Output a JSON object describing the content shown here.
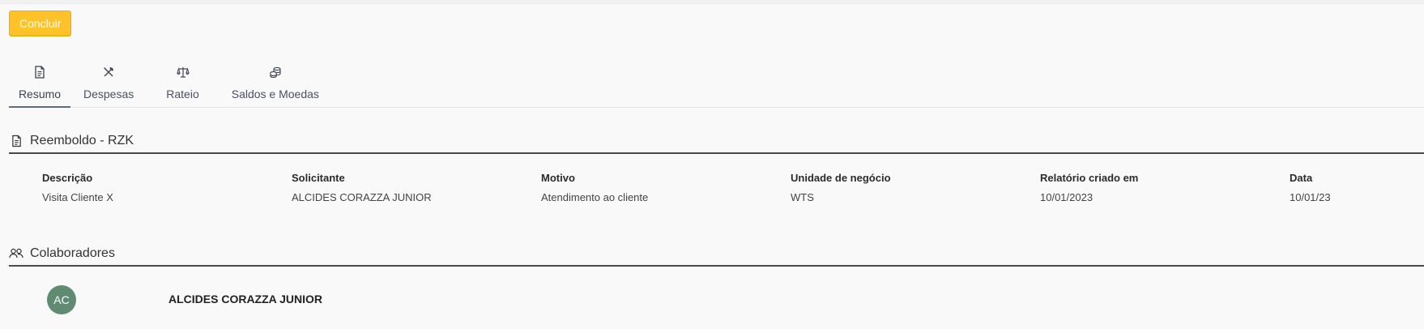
{
  "actions": {
    "conclude_label": "Concluir"
  },
  "tabs": [
    {
      "label": "Resumo",
      "icon": "document-icon",
      "active": true
    },
    {
      "label": "Despesas",
      "icon": "utensils-icon",
      "active": false
    },
    {
      "label": "Rateio",
      "icon": "scale-icon",
      "active": false
    },
    {
      "label": "Saldos e Moedas",
      "icon": "coins-icon",
      "active": false
    }
  ],
  "summary": {
    "title": "Reemboldo - RZK",
    "icon": "document-icon",
    "fields": [
      {
        "label": "Descrição",
        "value": "Visita Cliente X"
      },
      {
        "label": "Solicitante",
        "value": "ALCIDES CORAZZA JUNIOR"
      },
      {
        "label": "Motivo",
        "value": "Atendimento ao cliente"
      },
      {
        "label": "Unidade de negócio",
        "value": "WTS"
      },
      {
        "label": "Relatório criado em",
        "value": "10/01/2023"
      },
      {
        "label": "Data",
        "value": "10/01/23"
      }
    ]
  },
  "collaborators": {
    "title": "Colaboradores",
    "icon": "users-icon",
    "items": [
      {
        "initials": "AC",
        "name": "ALCIDES CORAZZA JUNIOR",
        "avatar_color": "#5f8b73"
      }
    ]
  },
  "colors": {
    "accent": "#ffc329",
    "tab_active": "#5e6d82"
  }
}
